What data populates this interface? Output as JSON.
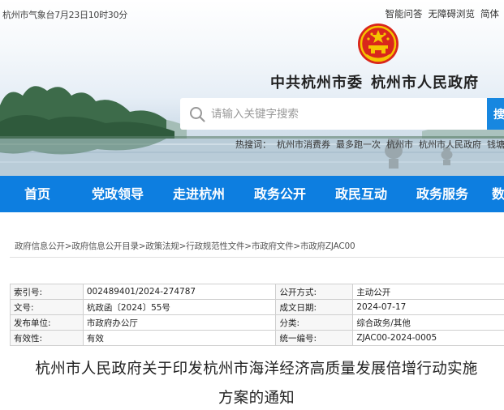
{
  "header": {
    "weather": "杭州市气象台7月23日10时30分",
    "top_links": [
      "智能问答",
      "无障碍浏览",
      "简体"
    ],
    "site_title_part1": "中共杭州市委",
    "site_title_part2": "杭州市人民政府",
    "search": {
      "placeholder": "请输入关键字搜索",
      "button_label": "搜"
    },
    "hot_words": [
      "热搜词：",
      "杭州市消费券",
      "最多跑一次",
      "杭州市",
      "杭州市人民政府",
      "钱塘"
    ]
  },
  "nav": {
    "items": [
      "首页",
      "党政领导",
      "走进杭州",
      "政务公开",
      "政民互动",
      "政务服务",
      "数"
    ]
  },
  "breadcrumb": "政府信息公开>政府信息公开目录>政策法规>行政规范性文件>市政府文件>市政府ZJAC00",
  "info_table": {
    "rows": [
      {
        "k1": "索引号:",
        "v1": "002489401/2024-274787",
        "k2": "公开方式:",
        "v2": "主动公开"
      },
      {
        "k1": "文号:",
        "v1": "杭政函〔2024〕55号",
        "k2": "成文日期:",
        "v2": "2024-07-17"
      },
      {
        "k1": "发布单位:",
        "v1": "市政府办公厅",
        "k2": "分类:",
        "v2": "综合政务/其他"
      },
      {
        "k1": "有效性:",
        "v1": "有效",
        "k2": "统一编号:",
        "v2": "ZJAC00-2024-0005"
      }
    ]
  },
  "document": {
    "title_line1": "杭州市人民政府关于印发杭州市海洋经济高质量发展倍增行动实施",
    "title_line2": "方案的通知"
  },
  "colors": {
    "nav_blue": "#0d7ee0",
    "emblem_red": "#d9261c",
    "emblem_gold": "#f5c400",
    "search_button": "#1787e0"
  },
  "icons": [
    "emblem-icon",
    "search-icon"
  ]
}
